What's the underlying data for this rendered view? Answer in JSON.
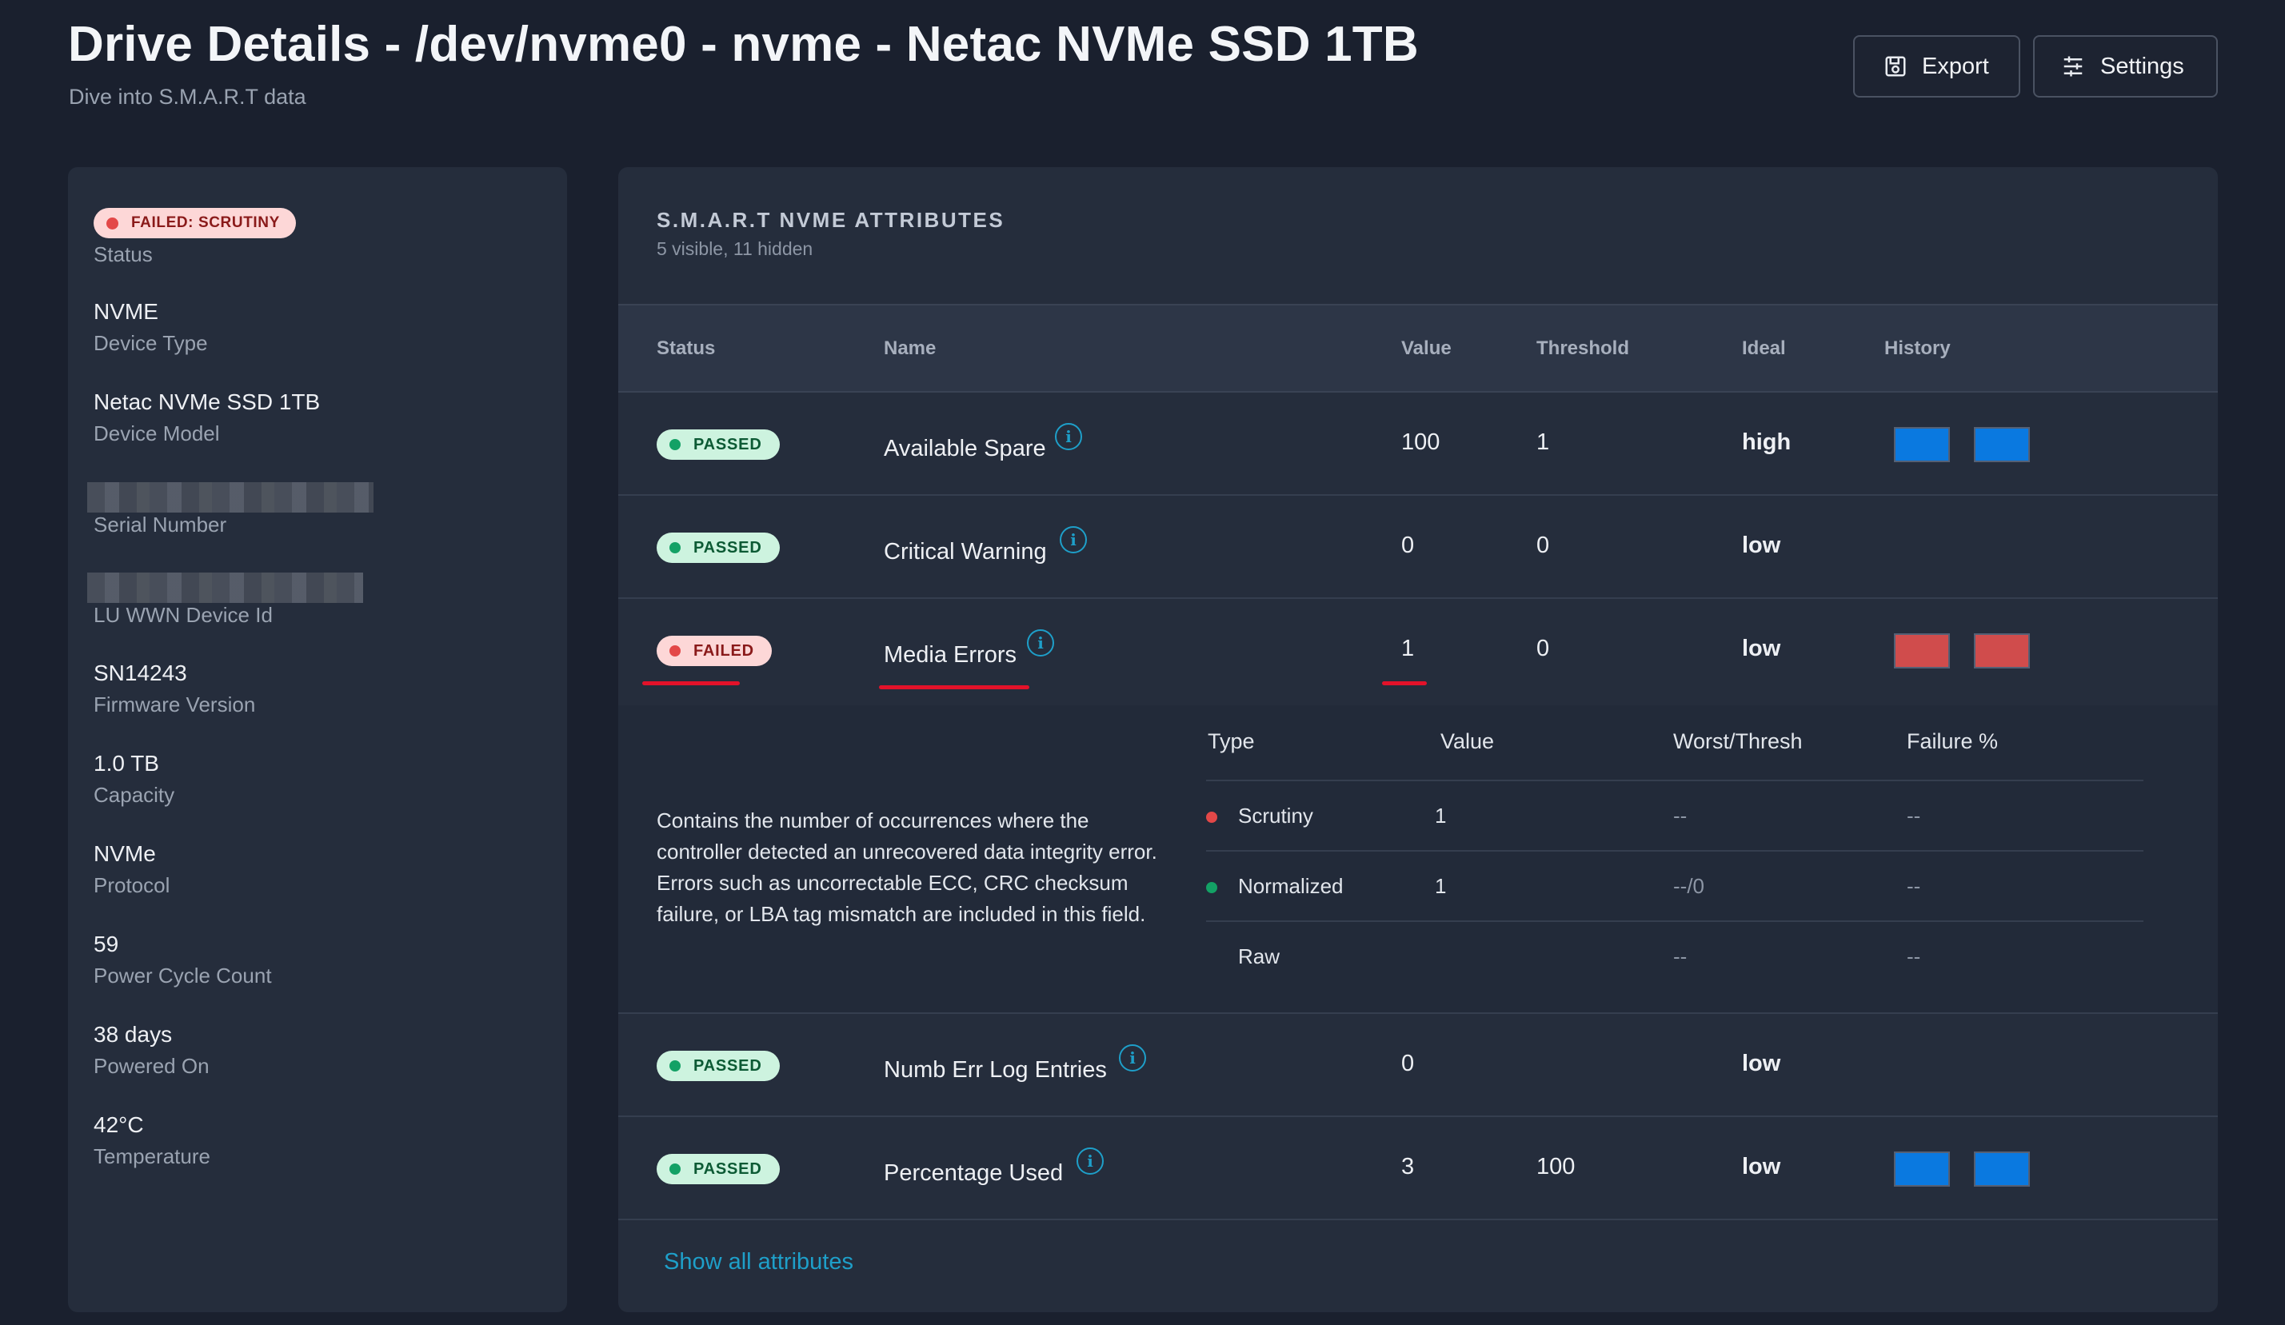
{
  "header": {
    "title": "Drive Details - /dev/nvme0 - nvme - Netac NVMe SSD 1TB",
    "subtitle": "Dive into S.M.A.R.T data",
    "export_label": "Export",
    "settings_label": "Settings"
  },
  "sidebar": {
    "status_badge": "FAILED: SCRUTINY",
    "status_label": "Status",
    "device_type": {
      "value": "NVME",
      "label": "Device Type"
    },
    "device_model": {
      "value": "Netac NVMe SSD 1TB",
      "label": "Device Model"
    },
    "serial_number": {
      "label": "Serial Number"
    },
    "wwn": {
      "label": "LU WWN Device Id"
    },
    "firmware": {
      "value": "SN14243",
      "label": "Firmware Version"
    },
    "capacity": {
      "value": "1.0 TB",
      "label": "Capacity"
    },
    "protocol": {
      "value": "NVMe",
      "label": "Protocol"
    },
    "power_cycle": {
      "value": "59",
      "label": "Power Cycle Count"
    },
    "powered_on": {
      "value": "38 days",
      "label": "Powered On"
    },
    "temperature": {
      "value": "42°C",
      "label": "Temperature"
    }
  },
  "attributes": {
    "title": "S.M.A.R.T NVME ATTRIBUTES",
    "subtitle": "5 visible, 11 hidden",
    "columns": {
      "status": "Status",
      "name": "Name",
      "value": "Value",
      "threshold": "Threshold",
      "ideal": "Ideal",
      "history": "History"
    },
    "rows": [
      {
        "status": "PASSED",
        "name": "Available Spare",
        "value": "100",
        "threshold": "1",
        "ideal": "high",
        "history": "blue"
      },
      {
        "status": "PASSED",
        "name": "Critical Warning",
        "value": "0",
        "threshold": "0",
        "ideal": "low",
        "history": ""
      },
      {
        "status": "FAILED",
        "name": "Media Errors",
        "value": "1",
        "threshold": "0",
        "ideal": "low",
        "history": "red"
      },
      {
        "status": "PASSED",
        "name": "Numb Err Log Entries",
        "value": "0",
        "threshold": "",
        "ideal": "low",
        "history": ""
      },
      {
        "status": "PASSED",
        "name": "Percentage Used",
        "value": "3",
        "threshold": "100",
        "ideal": "low",
        "history": "blue"
      }
    ],
    "detail": {
      "description": "Contains the number of occurrences where the controller detected an unrecovered data integrity error. Errors such as uncorrectable ECC, CRC checksum failure, or LBA tag mismatch are included in this field.",
      "columns": {
        "type": "Type",
        "value": "Value",
        "worst": "Worst/Thresh",
        "failure": "Failure %"
      },
      "rows": [
        {
          "type": "Scrutiny",
          "value": "1",
          "worst": "--",
          "failure": "--"
        },
        {
          "type": "Normalized",
          "value": "1",
          "worst": "--/0",
          "failure": "--"
        },
        {
          "type": "Raw",
          "value": "",
          "worst": "--",
          "failure": "--"
        }
      ]
    },
    "show_all": "Show all attributes"
  },
  "colors": {
    "background": "#1a202e",
    "panel": "#252d3c",
    "passed": "#13a165",
    "failed": "#e34848",
    "accent": "#1e9fc9",
    "history_blue": "#0a79e0",
    "history_red": "#d04c4c",
    "annotation": "#e3122a"
  },
  "icons": {
    "export": "save-icon",
    "settings": "sliders-icon",
    "info": "info-icon"
  }
}
